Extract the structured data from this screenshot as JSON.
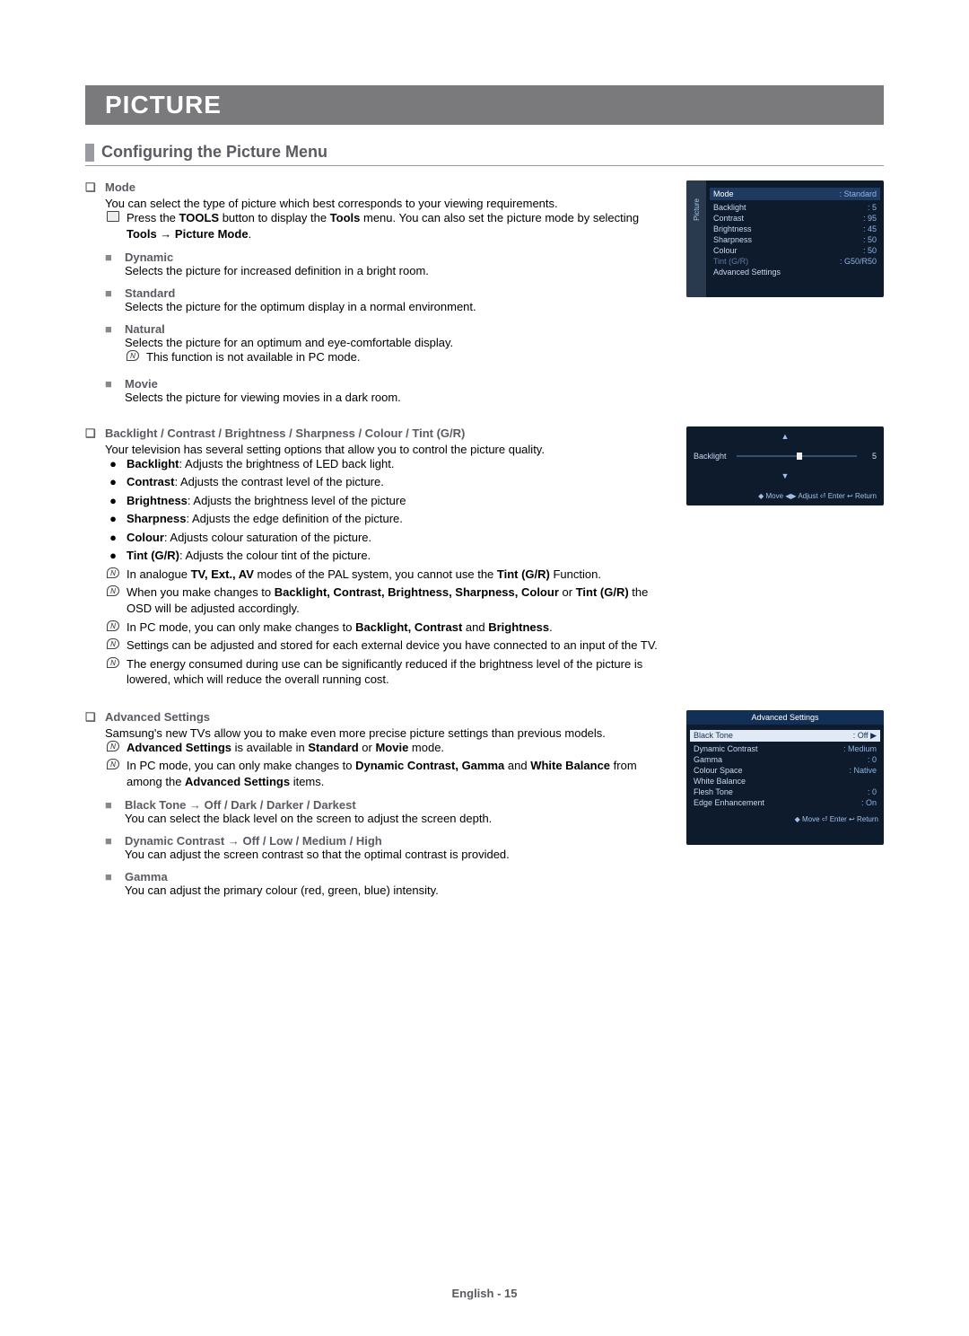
{
  "title": "PICTURE",
  "subtitle": "Configuring the Picture Menu",
  "mode": {
    "heading": "Mode",
    "intro": "You can select the type of picture which best corresponds to your viewing requirements.",
    "tools_pre": "Press the ",
    "tools_b1": "TOOLS",
    "tools_mid": " button to display the ",
    "tools_b2": "Tools",
    "tools_mid2": " menu. You can also set the picture mode by selecting ",
    "tools_b3": "Tools → Picture Mode",
    "tools_end": ".",
    "dynamic_h": "Dynamic",
    "dynamic_t": "Selects the picture for increased definition in a bright room.",
    "standard_h": "Standard",
    "standard_t": "Selects the picture for the optimum display in a normal environment.",
    "natural_h": "Natural",
    "natural_t": "Selects the picture for an optimum and eye-comfortable display.",
    "natural_note": "This function is not available in PC mode.",
    "movie_h": "Movie",
    "movie_t": "Selects the picture for viewing movies in a dark room."
  },
  "params": {
    "heading": "Backlight / Contrast / Brightness / Sharpness / Colour / Tint (G/R)",
    "intro": "Your television has several setting options that allow you to control the picture quality.",
    "b1_k": "Backlight",
    "b1_v": ": Adjusts the brightness of LED back light.",
    "b2_k": "Contrast",
    "b2_v": ": Adjusts the contrast level of the picture.",
    "b3_k": "Brightness",
    "b3_v": ": Adjusts the brightness level of the picture",
    "b4_k": "Sharpness",
    "b4_v": ": Adjusts the edge definition of the picture.",
    "b5_k": "Colour",
    "b5_v": ": Adjusts colour saturation of the picture.",
    "b6_k": "Tint (G/R)",
    "b6_v": ": Adjusts the colour tint of the picture.",
    "n1_a": "In analogue ",
    "n1_b": "TV, Ext., AV",
    "n1_c": " modes of the PAL system, you cannot use the ",
    "n1_d": "Tint (G/R)",
    "n1_e": " Function.",
    "n2_a": "When you make changes to ",
    "n2_b": "Backlight, Contrast, Brightness, Sharpness, Colour",
    "n2_c": " or ",
    "n2_d": "Tint (G/R)",
    "n2_e": " the OSD will be adjusted accordingly.",
    "n3_a": "In PC mode, you can only make changes to ",
    "n3_b": "Backlight, Contrast",
    "n3_c": " and ",
    "n3_d": "Brightness",
    "n3_e": ".",
    "n4": "Settings can be adjusted and stored for each external device you have connected to an input of the TV.",
    "n5": "The energy consumed during use can be significantly reduced if the brightness level of the picture is lowered, which will reduce the overall running cost."
  },
  "adv": {
    "heading": "Advanced Settings",
    "intro": "Samsung's new TVs allow you to make even more precise picture settings than previous models.",
    "n1_a": "Advanced Settings",
    "n1_b": " is available in ",
    "n1_c": "Standard",
    "n1_d": " or ",
    "n1_e": "Movie",
    "n1_f": " mode.",
    "n2_a": "In PC mode, you can only make changes to ",
    "n2_b": "Dynamic Contrast, Gamma",
    "n2_c": " and ",
    "n2_d": "White Balance",
    "n2_e": " from among the ",
    "n2_f": "Advanced Settings",
    "n2_g": " items.",
    "s1_h": "Black Tone → Off / Dark / Darker / Darkest",
    "s1_t": "You can select the black level on the screen to adjust the screen depth.",
    "s2_h": "Dynamic Contrast → Off / Low / Medium / High",
    "s2_t": "You can adjust the screen contrast so that the optimal contrast is provided.",
    "s3_h": "Gamma",
    "s3_t": "You can adjust the primary colour (red, green, blue) intensity."
  },
  "osd1": {
    "mode": "Mode",
    "mode_v": ": Standard",
    "r1k": "Backlight",
    "r1v": ": 5",
    "r2k": "Contrast",
    "r2v": ": 95",
    "r3k": "Brightness",
    "r3v": ": 45",
    "r4k": "Sharpness",
    "r4v": ": 50",
    "r5k": "Colour",
    "r5v": ": 50",
    "r6k": "Tint (G/R)",
    "r6v": ": G50/R50",
    "r7k": "Advanced Settings",
    "sidebarLabel": "Picture"
  },
  "osd2": {
    "label": "Backlight",
    "value": "5",
    "foot": "◆ Move   ◀▶ Adjust   ⏎ Enter   ↩ Return",
    "arrow_up": "▲",
    "arrow_dn": "▼"
  },
  "osd3": {
    "title": "Advanced Settings",
    "r1k": "Black Tone",
    "r1v": ": Off",
    "r2k": "Dynamic Contrast",
    "r2v": ": Medium",
    "r3k": "Gamma",
    "r3v": ": 0",
    "r4k": "Colour Space",
    "r4v": ": Native",
    "r5k": "White Balance",
    "r6k": "Flesh Tone",
    "r6v": ": 0",
    "r7k": "Edge Enhancement",
    "r7v": ": On",
    "play": "▶",
    "foot": "◆ Move   ⏎ Enter   ↩ Return"
  },
  "footer": "English - 15"
}
